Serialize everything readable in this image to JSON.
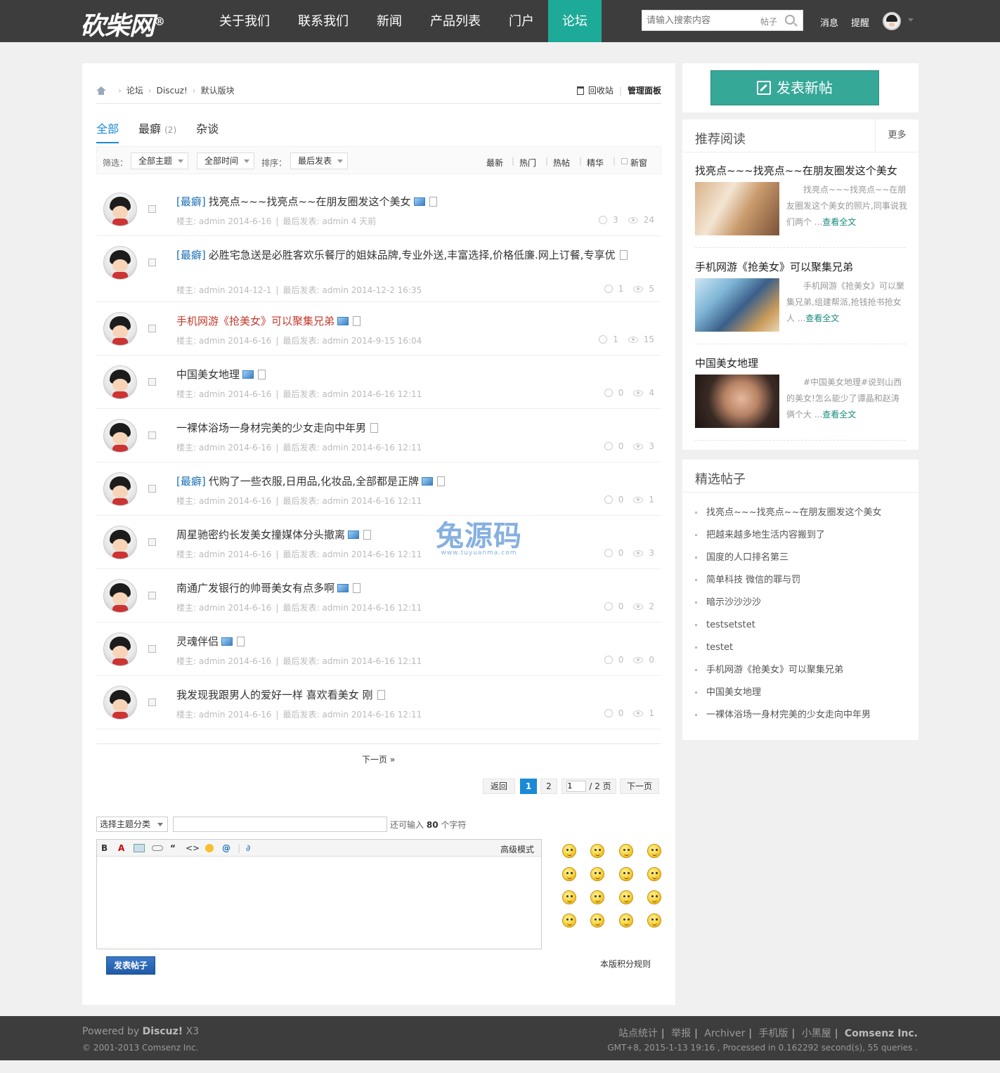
{
  "header": {
    "logo": "砍柴网",
    "logo_mark": "®",
    "nav": [
      "关于我们",
      "联系我们",
      "新闻",
      "产品列表",
      "门户",
      "论坛"
    ],
    "active_nav": "论坛",
    "search_placeholder": "请输入搜索内容",
    "search_scope": "帖子",
    "messages": "消息",
    "reminders": "提醒"
  },
  "breadcrumb": {
    "items": [
      "论坛",
      "Discuz!",
      "默认版块"
    ],
    "recycle": "回收站",
    "admin_panel": "管理面板"
  },
  "tabs": [
    {
      "label": "全部",
      "count": ""
    },
    {
      "label": "最癖",
      "count": "(2)"
    },
    {
      "label": "杂谈",
      "count": ""
    }
  ],
  "filter": {
    "filter_label": "筛选：",
    "type_value": "全部主题",
    "time_value": "全部时间",
    "sort_label": "排序：",
    "sort_value": "最后发表",
    "quick": [
      "最新",
      "热门",
      "热帖",
      "精华"
    ],
    "new_window": "新窗"
  },
  "thread_meta": {
    "author_label": "楼主:",
    "last_label": "最后发表:"
  },
  "threads": [
    {
      "tag": "[最癖]",
      "title": "找亮点~~~找亮点~~在朋友圈发这个美女",
      "author": "admin",
      "date": "2014-6-16",
      "last": "admin  4 天前",
      "replies": "3",
      "views": "24"
    },
    {
      "tag": "[最癖]",
      "title": "必胜宅急送是必胜客欢乐餐厅的姐妹品牌,专业外送,丰富选择,价格低廉.网上订餐,专享优",
      "author": "admin",
      "date": "2014-12-1",
      "last": "admin 2014-12-2 16:35",
      "replies": "1",
      "views": "5"
    },
    {
      "tag": "",
      "title": "手机网游《抢美女》可以聚集兄弟",
      "author": "admin",
      "date": "2014-6-16",
      "last": "admin 2014-9-15 16:04",
      "replies": "1",
      "views": "15"
    },
    {
      "tag": "",
      "title": "中国美女地理",
      "author": "admin",
      "date": "2014-6-16",
      "last": "admin 2014-6-16 12:11",
      "replies": "0",
      "views": "4"
    },
    {
      "tag": "",
      "title": "一裸体浴场一身材完美的少女走向中年男",
      "author": "admin",
      "date": "2014-6-16",
      "last": "admin 2014-6-16 12:11",
      "replies": "0",
      "views": "3"
    },
    {
      "tag": "[最癖]",
      "title": "代购了一些衣服,日用品,化妆品,全部都是正牌",
      "author": "admin",
      "date": "2014-6-16",
      "last": "admin 2014-6-16 12:11",
      "replies": "0",
      "views": "1"
    },
    {
      "tag": "",
      "title": "周星驰密约长发美女撞媒体分头撤离",
      "author": "admin",
      "date": "2014-6-16",
      "last": "admin 2014-6-16 12:11",
      "replies": "0",
      "views": "3"
    },
    {
      "tag": "",
      "title": "南通广发银行的帅哥美女有点多啊",
      "author": "admin",
      "date": "2014-6-16",
      "last": "admin 2014-6-16 12:11",
      "replies": "0",
      "views": "2"
    },
    {
      "tag": "",
      "title": "灵魂伴侣",
      "author": "admin",
      "date": "2014-6-16",
      "last": "admin 2014-6-16 12:11",
      "replies": "0",
      "views": "0"
    },
    {
      "tag": "",
      "title": "我发现我跟男人的爱好一样 喜欢看美女 刚",
      "author": "admin",
      "date": "2014-6-16",
      "last": "admin 2014-6-16 12:11",
      "replies": "0",
      "views": "1"
    }
  ],
  "pagination": {
    "next_link": "下一页 »",
    "back": "返回",
    "pages": [
      "1",
      "2"
    ],
    "current": "1",
    "jump_value": "1",
    "total": "/ 2 页",
    "next": "下一页"
  },
  "quickpost": {
    "category": "选择主题分类",
    "remain_prefix": "还可输入",
    "remain_count": "80",
    "remain_suffix": "个字符",
    "advanced": "高级模式",
    "submit": "发表帖子",
    "rules": "本版积分规则"
  },
  "sidebar": {
    "new_post": "发表新帖",
    "rec_title": "推荐阅读",
    "rec_more": "更多",
    "rec_items": [
      {
        "title": "找亮点~~~找亮点~~在朋友圈发这个美女",
        "summary": "找亮点~~~找亮点~~在朋友圈发这个美女的照片,同事说我们两个 ...",
        "more": "查看全文"
      },
      {
        "title": "手机网游《抢美女》可以聚集兄弟",
        "summary": "手机网游《抢美女》可以聚集兄弟,组建帮派,抢钱抢书抢女人 ...",
        "more": "查看全文"
      },
      {
        "title": "中国美女地理",
        "summary": "#中国美女地理#说到山西的美女!怎么能少了谭晶和赵涛俩个大 ...",
        "more": "查看全文"
      }
    ],
    "picks_title": "精选帖子",
    "picks": [
      "找亮点~~~找亮点~~在朋友圈发这个美女",
      "把越来越多地生活内容搬到了",
      "国度的人口排名第三",
      "简单科技 微信的罪与罚",
      "暗示沙沙沙沙",
      "testsetstet",
      "testet",
      "手机网游《抢美女》可以聚集兄弟",
      "中国美女地理",
      "一裸体浴场一身材完美的少女走向中年男"
    ]
  },
  "watermark": {
    "text": "兔源码",
    "url": "www.tuyuanma.com"
  },
  "footer": {
    "powered_prefix": "Powered by",
    "powered_name": "Discuz!",
    "powered_ver": "X3",
    "copyright": "© 2001-2013 Comsenz Inc.",
    "links": [
      "站点统计",
      "举报",
      "Archiver",
      "手机版",
      "小黑屋"
    ],
    "company": "Comsenz Inc.",
    "stat": "GMT+8, 2015-1-13 19:16 , Processed in 0.162292 second(s), 55 queries ."
  }
}
